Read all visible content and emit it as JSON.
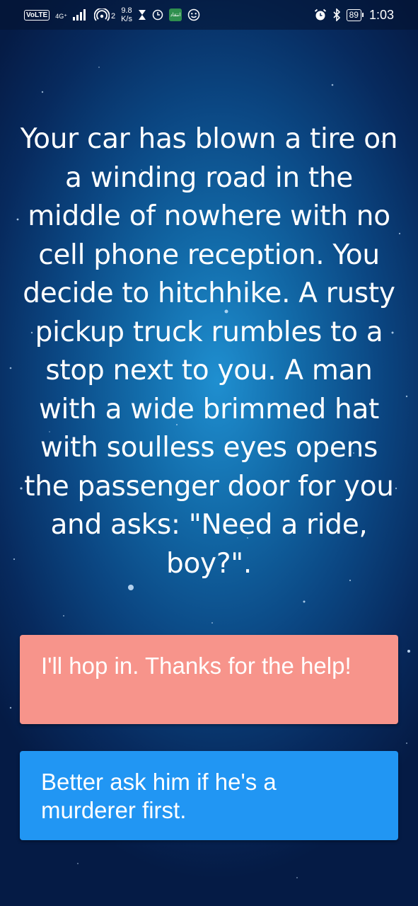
{
  "status_bar": {
    "volte": "VoLTE",
    "network_type": "4G⁺",
    "hotspot_count": "2",
    "speed_value": "9.8",
    "speed_unit": "K/s",
    "app_icon_text": "انتقاد",
    "battery_level": "89",
    "time": "1:03"
  },
  "story": {
    "text": "Your car has blown a tire on a winding road in the middle of nowhere with no cell phone reception. You decide to hitchhike. A rusty pickup truck rumbles to a stop next to you. A man with a wide brimmed hat with soulless eyes opens the passenger door for you and asks: \"Need a ride, boy?\"."
  },
  "choices": [
    {
      "label": "I'll hop in. Thanks for the help!",
      "color": "#f7948b"
    },
    {
      "label": "Better ask him if he's a murderer first.",
      "color": "#2196f3"
    }
  ],
  "colors": {
    "background": "#0b4783",
    "text": "#ffffff"
  }
}
